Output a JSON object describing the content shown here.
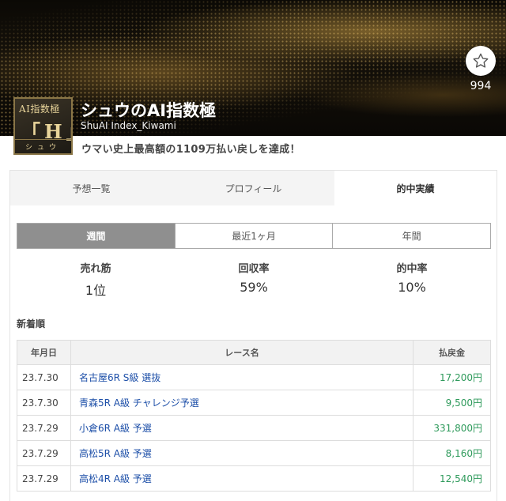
{
  "profile": {
    "title": "シュウのAI指数極",
    "subtitle": "ShuAI Index_Kiwami",
    "tagline": "ウマい史上最高額の1109万払い戻しを達成！",
    "favorite_count": "994",
    "logo": {
      "line1": "AI指数極",
      "line2": "「H」",
      "line3": "シュウ"
    }
  },
  "tabs": [
    {
      "label": "予想一覧",
      "active": false
    },
    {
      "label": "プロフィール",
      "active": false
    },
    {
      "label": "的中実績",
      "active": true
    }
  ],
  "periods": [
    {
      "label": "週間",
      "active": true
    },
    {
      "label": "最近1ヶ月",
      "active": false
    },
    {
      "label": "年間",
      "active": false
    }
  ],
  "stats": [
    {
      "label": "売れ筋",
      "value": "1位"
    },
    {
      "label": "回収率",
      "value": "59%"
    },
    {
      "label": "的中率",
      "value": "10%"
    }
  ],
  "section_title": "新着順",
  "table": {
    "headers": [
      "年月日",
      "レース名",
      "払戻金"
    ],
    "rows": [
      {
        "date": "23.7.30",
        "race": "名古屋6R  S級 選抜",
        "payout": "17,200円"
      },
      {
        "date": "23.7.30",
        "race": "青森5R  A級 チャレンジ予選",
        "payout": "9,500円"
      },
      {
        "date": "23.7.29",
        "race": "小倉6R  A級 予選",
        "payout": "331,800円"
      },
      {
        "date": "23.7.29",
        "race": "高松5R  A級 予選",
        "payout": "8,160円"
      },
      {
        "date": "23.7.29",
        "race": "高松4R  A級 予選",
        "payout": "12,540円"
      }
    ]
  },
  "colors": {
    "payout": "#2e9a5b",
    "link": "#1d4fa8",
    "active_period": "#8f8f8f"
  },
  "icons": {
    "favorite": "star-icon"
  }
}
